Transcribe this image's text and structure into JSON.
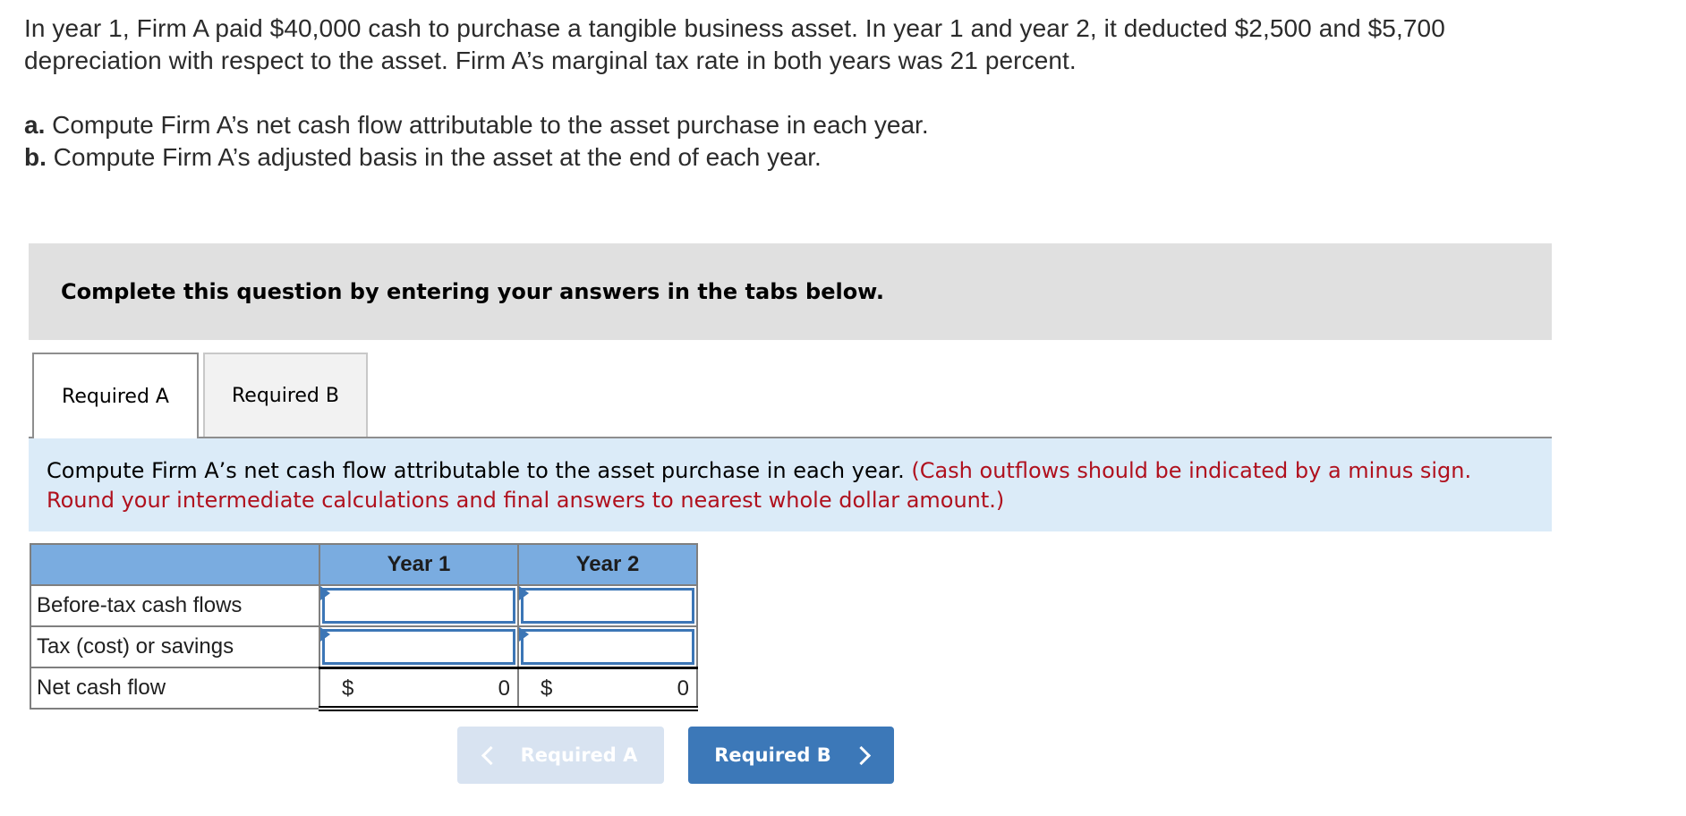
{
  "problem": {
    "line1": "In year 1, Firm A paid $40,000 cash to purchase a tangible business asset. In year 1 and year 2, it deducted $2,500 and $5,700",
    "line2": "depreciation with respect to the asset. Firm A’s marginal tax rate in both years was 21 percent.",
    "parts": [
      {
        "marker": "a.",
        "text": " Compute Firm A’s net cash flow attributable to the asset purchase in each year."
      },
      {
        "marker": "b.",
        "text": " Compute Firm A’s adjusted basis in the asset at the end of each year."
      }
    ]
  },
  "banner": {
    "text": "Complete this question by entering your answers in the tabs below."
  },
  "tabs": [
    {
      "label": "Required A",
      "active": true
    },
    {
      "label": "Required B",
      "active": false
    }
  ],
  "instruction": {
    "main": "Compute Firm A’s net cash flow attributable to the asset purchase in each year. ",
    "note": "(Cash outflows should be indicated by a minus sign. Round your intermediate calculations and final answers to nearest whole dollar amount.)"
  },
  "table": {
    "columns": [
      "",
      "Year 1",
      "Year 2"
    ],
    "rows": [
      {
        "label": "Before-tax cash flows",
        "year1": "",
        "year2": ""
      },
      {
        "label": "Tax (cost) or savings",
        "year1": "",
        "year2": ""
      },
      {
        "label": "Net cash flow",
        "currency": "$",
        "year1": "0",
        "year2": "0"
      }
    ]
  },
  "nav": {
    "prev_label": "Required A",
    "next_label": "Required B"
  },
  "colors": {
    "header_blue": "#7aace0",
    "input_border": "#3c76b6",
    "note_red": "#b0111e",
    "next_button": "#3c78b8",
    "prev_button_disabled": "#d8e3f1",
    "instruction_bg": "#dbebf8",
    "banner_bg": "#e0e0e0"
  }
}
